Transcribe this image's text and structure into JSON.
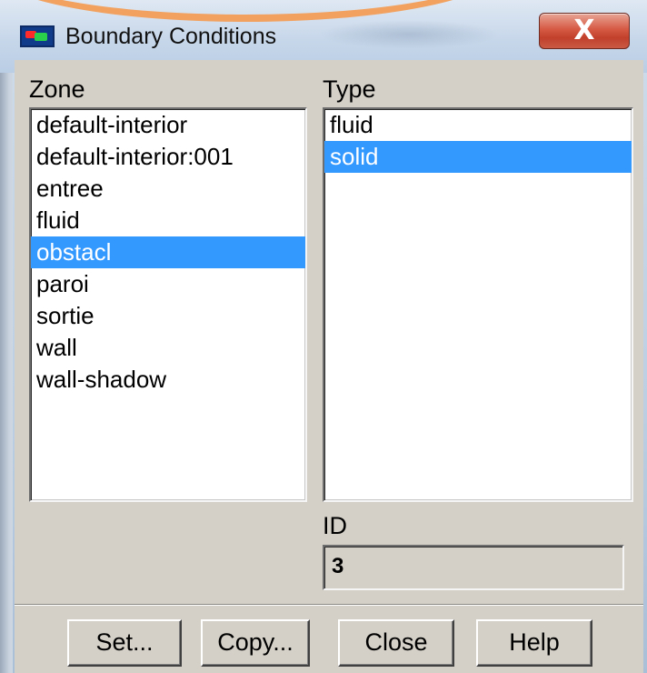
{
  "window": {
    "title": "Boundary Conditions",
    "close_glyph": "X",
    "icon": "fluent-app-icon"
  },
  "zone": {
    "label": "Zone",
    "items": [
      "default-interior",
      "default-interior:001",
      "entree",
      "fluid",
      "obstacl",
      "paroi",
      "sortie",
      "wall",
      "wall-shadow"
    ],
    "selected": "obstacl"
  },
  "type": {
    "label": "Type",
    "items": [
      "fluid",
      "solid"
    ],
    "selected": "solid"
  },
  "id": {
    "label": "ID",
    "value": "3"
  },
  "buttons": {
    "set": "Set...",
    "copy": "Copy...",
    "close": "Close",
    "help": "Help"
  },
  "colors": {
    "selection": "#3399ff",
    "dialog_bg": "#d4d0c8",
    "highlight_ellipse": "#f2a15f"
  }
}
